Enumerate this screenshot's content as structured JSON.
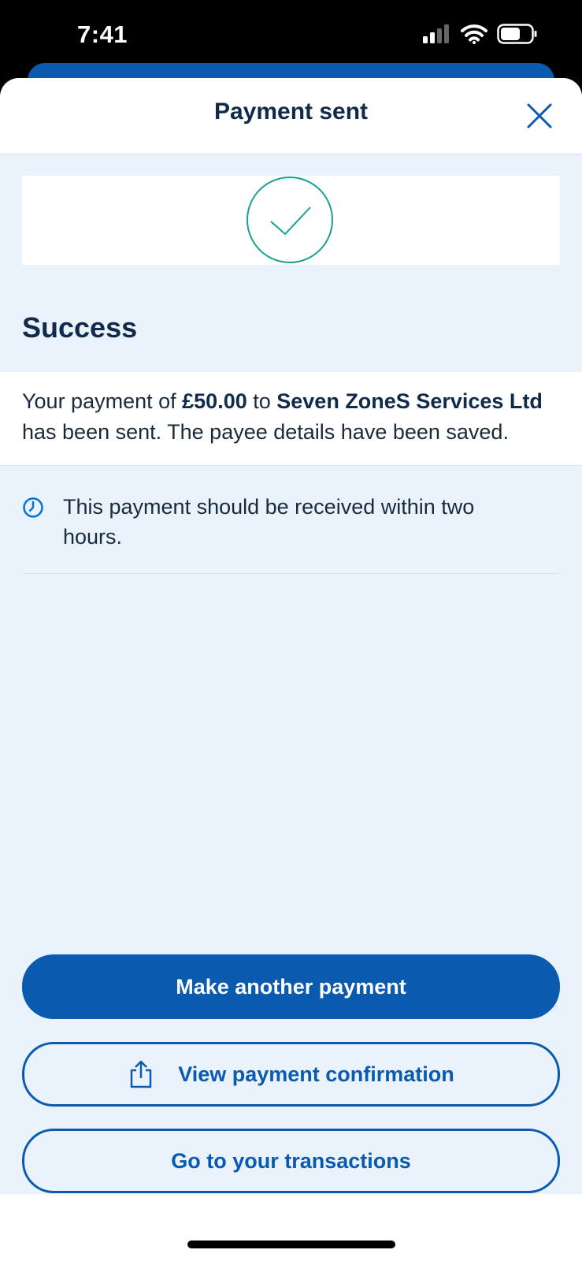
{
  "status_bar": {
    "time": "7:41"
  },
  "sheet": {
    "title": "Payment sent"
  },
  "success": {
    "heading": "Success",
    "message_prefix": "Your payment of ",
    "amount": "£50.00",
    "message_mid": " to ",
    "payee": "Seven ZoneS Services Ltd",
    "message_suffix": " has been sent. The payee details have been saved."
  },
  "info": {
    "text": "This payment should be received within two hours."
  },
  "actions": {
    "make_another": "Make another payment",
    "view_confirmation": "View payment confirmation",
    "go_transactions": "Go to your transactions"
  },
  "colors": {
    "primary": "#0a5bb0",
    "check_teal": "#1a9e94",
    "background": "#eaf3fc",
    "text_dark": "#0f2a4a"
  },
  "icons": {
    "close": "close-icon",
    "check": "check-circle-icon",
    "clock": "clock-icon",
    "share": "share-icon"
  }
}
